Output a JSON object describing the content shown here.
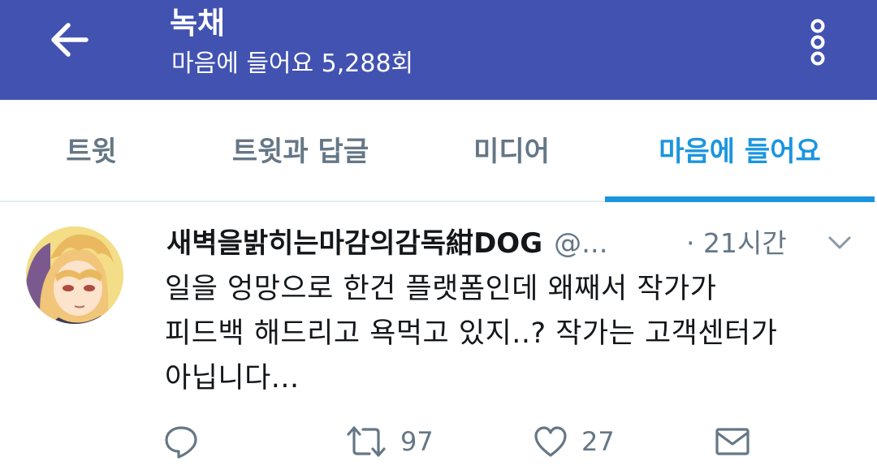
{
  "header": {
    "title": "녹채",
    "subtitle": "마음에 들어요 5,288회",
    "back_icon": "arrow-left-icon",
    "more_icon": "vertical-dots-icon",
    "bg_color": "#4152b1"
  },
  "tabs": [
    {
      "label": "트윗",
      "active": false
    },
    {
      "label": "트윗과 답글",
      "active": false
    },
    {
      "label": "미디어",
      "active": false
    },
    {
      "label": "마음에 들어요",
      "active": true
    }
  ],
  "tweet": {
    "display_name": "새벽을밝히는마감의감독紺DOG",
    "handle": "@...",
    "time": "· 21시간",
    "text_lines": [
      "일을 엉망으로 한건 플랫폼인데 왜째서 작가가",
      "피드백 해드리고 욕먹고 있지..? 작가는 고객센터가",
      "아닙니다..."
    ],
    "actions": {
      "reply_icon": "reply-icon",
      "retweet_icon": "retweet-icon",
      "retweet_count": "97",
      "like_icon": "heart-icon",
      "like_count": "27",
      "dm_icon": "envelope-icon"
    }
  },
  "colors": {
    "accent": "#1b95e0",
    "muted": "#657786",
    "text": "#14171a"
  }
}
